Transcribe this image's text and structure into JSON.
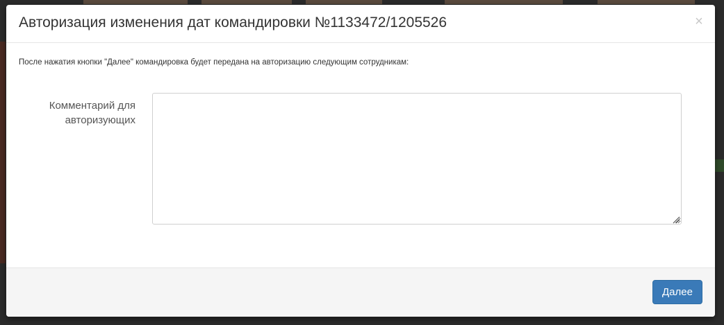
{
  "modal": {
    "title": "Авторизация изменения дат командировки №1133472/1205526",
    "close_symbol": "×",
    "info_text": "После нажатия кнопки \"Далее\" командировка будет передана на авторизацию следующим сотрудникам:",
    "comment_label": "Комментарий для авторизующих",
    "comment_value": "",
    "next_button_label": "Далее"
  },
  "colors": {
    "primary_button": "#3a7ab8",
    "footer_background": "#f5f5f5",
    "overlay": "#2b2b2b"
  },
  "icons": {
    "close": "close-icon",
    "resize": "resize-grip-icon"
  }
}
